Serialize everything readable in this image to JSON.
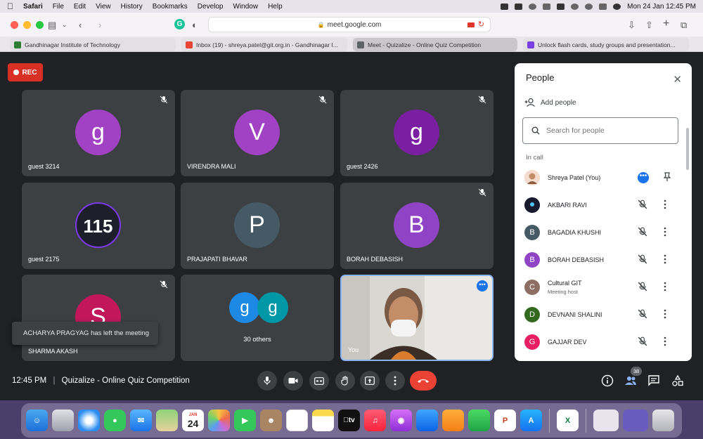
{
  "menubar": {
    "app": "Safari",
    "items": [
      "File",
      "Edit",
      "View",
      "History",
      "Bookmarks",
      "Develop",
      "Window",
      "Help"
    ],
    "datetime": "Mon 24 Jan  12:45 PM"
  },
  "browser": {
    "url": "meet.google.com",
    "tabs": [
      {
        "title": "Gandhinagar Institute of Technology",
        "fav_color": "#2e7d32"
      },
      {
        "title": "Inbox (19) - shreya.patel@git.org.in - Gandhinagar I...",
        "fav_color": "#ea4335"
      },
      {
        "title": "Meet - Quizalize - Online Quiz Competition",
        "fav_color": "#5f6368"
      },
      {
        "title": "Unlock flash cards, study groups and presentation...",
        "fav_color": "#7b3fe4"
      }
    ]
  },
  "meeting": {
    "rec_label": "REC",
    "tiles": [
      {
        "name": "guest 3214",
        "initial": "g",
        "color": "#a142c4"
      },
      {
        "name": "VIRENDRA MALI",
        "initial": "V",
        "color": "#a142c4"
      },
      {
        "name": "guest 2426",
        "initial": "g",
        "color": "#7b1fa2"
      },
      {
        "name": "guest 2175",
        "initial": "115",
        "color": "#1e1f2a"
      },
      {
        "name": "PRAJAPATI BHAVAR",
        "initial": "P",
        "color": "#455a64"
      },
      {
        "name": "BORAH DEBASISH",
        "initial": "B",
        "color": "#8e44c4"
      },
      {
        "name": "SHARMA AKASH",
        "initial": "S",
        "color": "#c2185b"
      },
      {
        "name": "30 others",
        "initial_a": "g",
        "initial_b": "g",
        "color_a": "#1e88e5",
        "color_b": "#0097a7"
      },
      {
        "name": "You"
      }
    ],
    "toast": "ACHARYA PRAGYAG has left the meeting",
    "time": "12:45 PM",
    "title": "Quizalize - Online Quiz Competition",
    "participant_count": "38"
  },
  "people_panel": {
    "title": "People",
    "add_people": "Add people",
    "search_placeholder": "Search for people",
    "section": "In call",
    "people": [
      {
        "name": "Shreya Patel (You)",
        "initial": "",
        "color": "#f0c9b0"
      },
      {
        "name": "AKBARI RAVI",
        "initial": "",
        "color": "#1a1a2e"
      },
      {
        "name": "BAGADIA KHUSHI",
        "initial": "B",
        "color": "#455a64"
      },
      {
        "name": "BORAH DEBASISH",
        "initial": "B",
        "color": "#8e44c4"
      },
      {
        "name": "Cultural GIT",
        "sub": "Meeting host",
        "initial": "C",
        "color": "#8d6e63"
      },
      {
        "name": "DEVNANI SHALINI",
        "initial": "D",
        "color": "#33691e"
      },
      {
        "name": "GAJJAR DEV",
        "initial": "G",
        "color": "#e91e63"
      }
    ]
  },
  "dock": {
    "calendar_month": "JAN",
    "calendar_day": "24",
    "tv_label": "tv"
  }
}
